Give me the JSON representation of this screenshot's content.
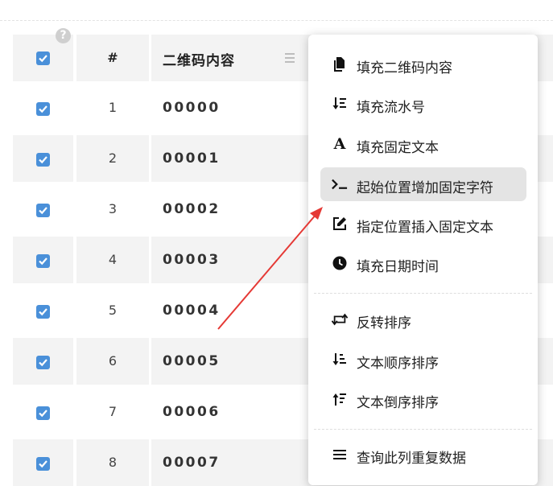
{
  "table": {
    "header": {
      "number": "#",
      "qr_content": "二维码内容"
    },
    "rows": [
      {
        "number": "1",
        "qr": "00000"
      },
      {
        "number": "2",
        "qr": "00001"
      },
      {
        "number": "3",
        "qr": "00002"
      },
      {
        "number": "4",
        "qr": "00003"
      },
      {
        "number": "5",
        "qr": "00004"
      },
      {
        "number": "6",
        "qr": "00005"
      },
      {
        "number": "7",
        "qr": "00006"
      },
      {
        "number": "8",
        "qr": "00007"
      }
    ]
  },
  "menu": {
    "items": [
      {
        "label": "填充二维码内容",
        "icon": "file-copy-icon"
      },
      {
        "label": "填充流水号",
        "icon": "sort-numeric-icon"
      },
      {
        "label": "填充固定文本",
        "icon": "font-a-icon"
      },
      {
        "label": "起始位置增加固定字符",
        "icon": "terminal-icon"
      },
      {
        "label": "指定位置插入固定文本",
        "icon": "edit-icon"
      },
      {
        "label": "填充日期时间",
        "icon": "clock-icon"
      },
      {
        "label": "反转排序",
        "icon": "retweet-icon"
      },
      {
        "label": "文本顺序排序",
        "icon": "sort-asc-icon"
      },
      {
        "label": "文本倒序排序",
        "icon": "sort-desc-icon"
      },
      {
        "label": "查询此列重复数据",
        "icon": "list-icon"
      }
    ]
  },
  "colors": {
    "checkbox": "#4a90d9",
    "arrow": "#e53935",
    "row_alt": "#f3f3f3",
    "menu_active": "#e4e4e4"
  }
}
